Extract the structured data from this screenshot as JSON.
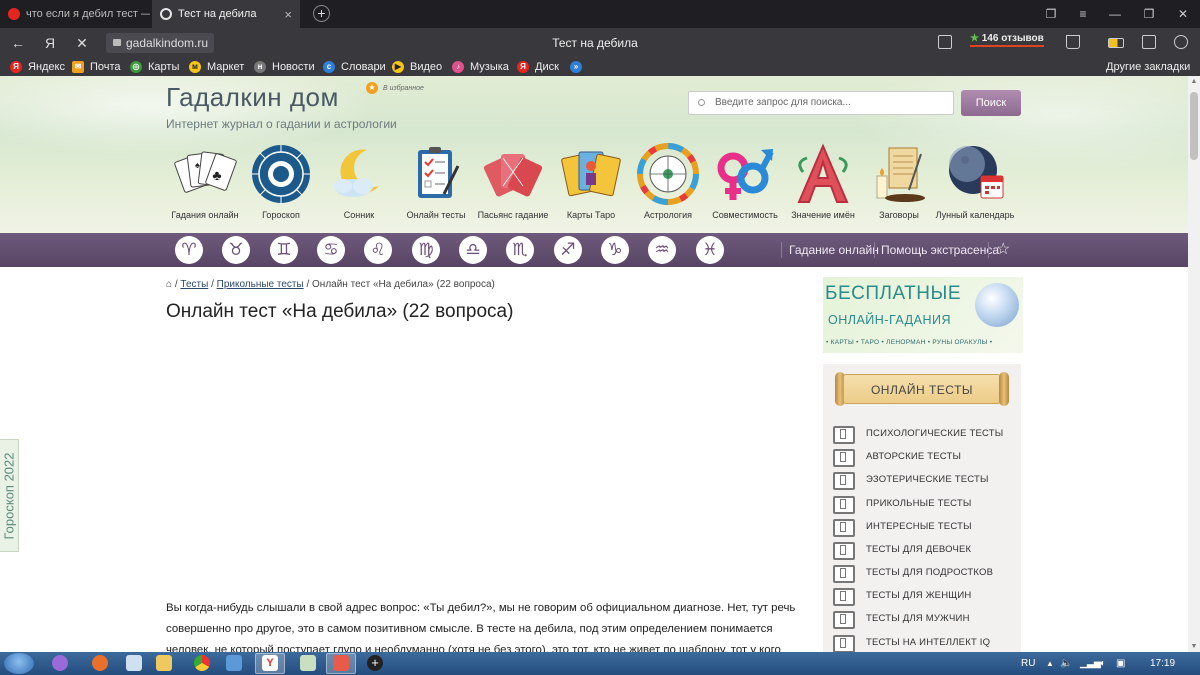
{
  "browser": {
    "tabs": [
      {
        "label": "что если я дебил тест — Я"
      },
      {
        "label": "Тест на дебила"
      }
    ],
    "url": "gadalkindom.ru",
    "page_title": "Тест на дебила",
    "reviews": "146 отзывов",
    "reviews_star": "★",
    "bookmarks": [
      "Яндекс",
      "Почта",
      "Карты",
      "Маркет",
      "Новости",
      "Словари",
      "Видео",
      "Музыка",
      "Диск"
    ],
    "other_bookmarks": "Другие закладки"
  },
  "site": {
    "title": "Гадалкин дом",
    "subtitle": "Интернет журнал о гадании и астрологии",
    "favorites_label": "В избранное",
    "search_placeholder": "Введите запрос для поиска...",
    "search_button": "Поиск"
  },
  "categories": [
    {
      "label": "Гадания онлайн",
      "icon": "playing-cards-icon"
    },
    {
      "label": "Гороскоп",
      "icon": "zodiac-wheel-icon"
    },
    {
      "label": "Сонник",
      "icon": "moon-cloud-icon"
    },
    {
      "label": "Онлайн тесты",
      "icon": "checklist-icon"
    },
    {
      "label": "Пасьянс гадание",
      "icon": "cards-fan-icon"
    },
    {
      "label": "Карты Таро",
      "icon": "tarot-cards-icon"
    },
    {
      "label": "Астрология",
      "icon": "astrology-wheel-icon"
    },
    {
      "label": "Совместимость",
      "icon": "gender-symbols-icon"
    },
    {
      "label": "Значение имён",
      "icon": "letter-a-icon"
    },
    {
      "label": "Заговоры",
      "icon": "scroll-candle-icon"
    },
    {
      "label": "Лунный календарь",
      "icon": "moon-calendar-icon"
    }
  ],
  "zodiac_nav": {
    "signs": [
      "♈",
      "♉",
      "♊",
      "♋",
      "♌",
      "♍",
      "♎",
      "♏",
      "♐",
      "♑",
      "♒",
      "♓"
    ],
    "links": [
      "Гадание онлайн",
      "Помощь экстрасенса"
    ]
  },
  "breadcrumb": {
    "sep1": "/",
    "link1": "Тесты",
    "sep2": "/",
    "link2": "Прикольные тесты",
    "current": "/ Онлайн тест «На дебила» (22 вопроса)"
  },
  "heading": "Онлайн тест «На дебила» (22 вопроса)",
  "body_text": "Вы когда-нибудь слышали в свой адрес вопрос: «Ты дебил?», мы не говорим об официальном диагнозе. Нет, тут речь совершенно про другое, это в самом позитивном смысле. В тесте на дебила, под этим определением понимается человек, не который поступает глупо и необдуманно (хотя не без этого), это тот, кто не живет по шаблону, тот у кого",
  "promo": {
    "line1": "БЕСПЛАТНЫЕ",
    "line2": "ОНЛАЙН-ГАДАНИЯ",
    "line3": "• КАРТЫ • ТАРО • ЛЕНОРМАН • РУНЫ ОРАКУЛЫ •"
  },
  "sidebar": {
    "title": "ОНЛАЙН ТЕСТЫ",
    "items": [
      "Психологические тесты",
      "Авторские тесты",
      "Эзотерические тесты",
      "Прикольные тесты",
      "Интересные тесты",
      "Тесты для девочек",
      "Тесты для подростков",
      "Тесты для женщин",
      "Тесты для мужчин",
      "Тесты на интеллект IQ"
    ]
  },
  "side_tab": "Гороскоп 2022",
  "taskbar": {
    "lang": "RU",
    "time": "17:19"
  },
  "colors": {
    "accent_purple": "#6e5a7c",
    "title_teal": "#2b8a8c"
  }
}
